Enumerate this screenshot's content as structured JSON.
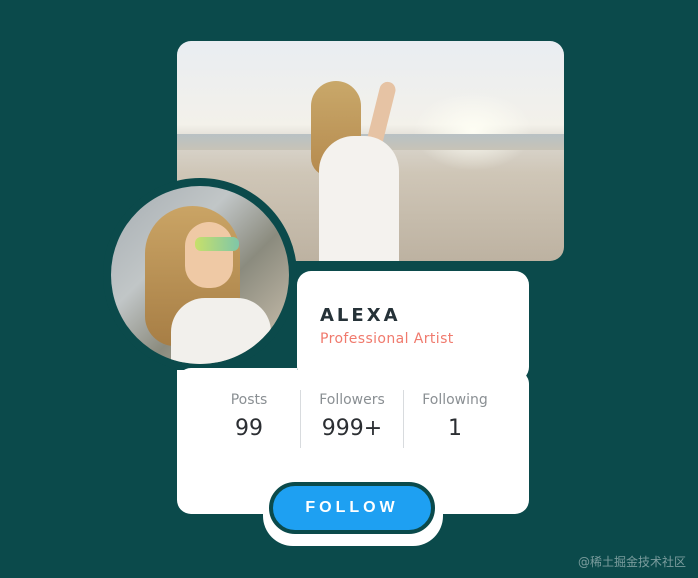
{
  "profile": {
    "name": "ALEXA",
    "role": "Professional Artist"
  },
  "stats": [
    {
      "label": "Posts",
      "value": "99"
    },
    {
      "label": "Followers",
      "value": "999+"
    },
    {
      "label": "Following",
      "value": "1"
    }
  ],
  "follow_button": {
    "label": "FOLLOW"
  },
  "watermark": "@稀土掘金技术社区",
  "colors": {
    "background": "#0b4a4b",
    "card": "#ffffff",
    "accent_button": "#1ea0f2",
    "role_text": "#f07a6d"
  }
}
